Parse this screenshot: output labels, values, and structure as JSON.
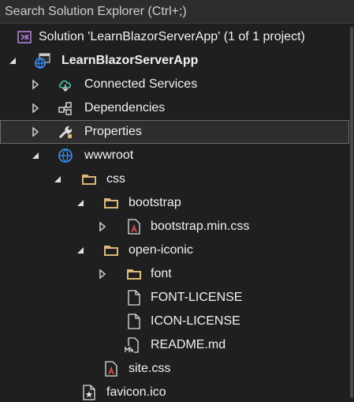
{
  "search": {
    "placeholder": "Search Solution Explorer (Ctrl+;)"
  },
  "tree": {
    "solution": "Solution 'LearnBlazorServerApp' (1 of 1 project)",
    "project": "LearnBlazorServerApp",
    "connected_services": "Connected Services",
    "dependencies": "Dependencies",
    "properties": "Properties",
    "wwwroot": "wwwroot",
    "css": "css",
    "bootstrap": "bootstrap",
    "bootstrap_min_css": "bootstrap.min.css",
    "open_iconic": "open-iconic",
    "font": "font",
    "font_license": "FONT-LICENSE",
    "icon_license": "ICON-LICENSE",
    "readme": "README.md",
    "site_css": "site.css",
    "favicon": "favicon.ico"
  },
  "colors": {
    "background": "#1f1f1f",
    "selection_border": "#6a6a6a",
    "folder": "#dcb67a",
    "solution_icon": "#b180d7",
    "globe": "#3794ff",
    "css_red": "#e05252"
  }
}
